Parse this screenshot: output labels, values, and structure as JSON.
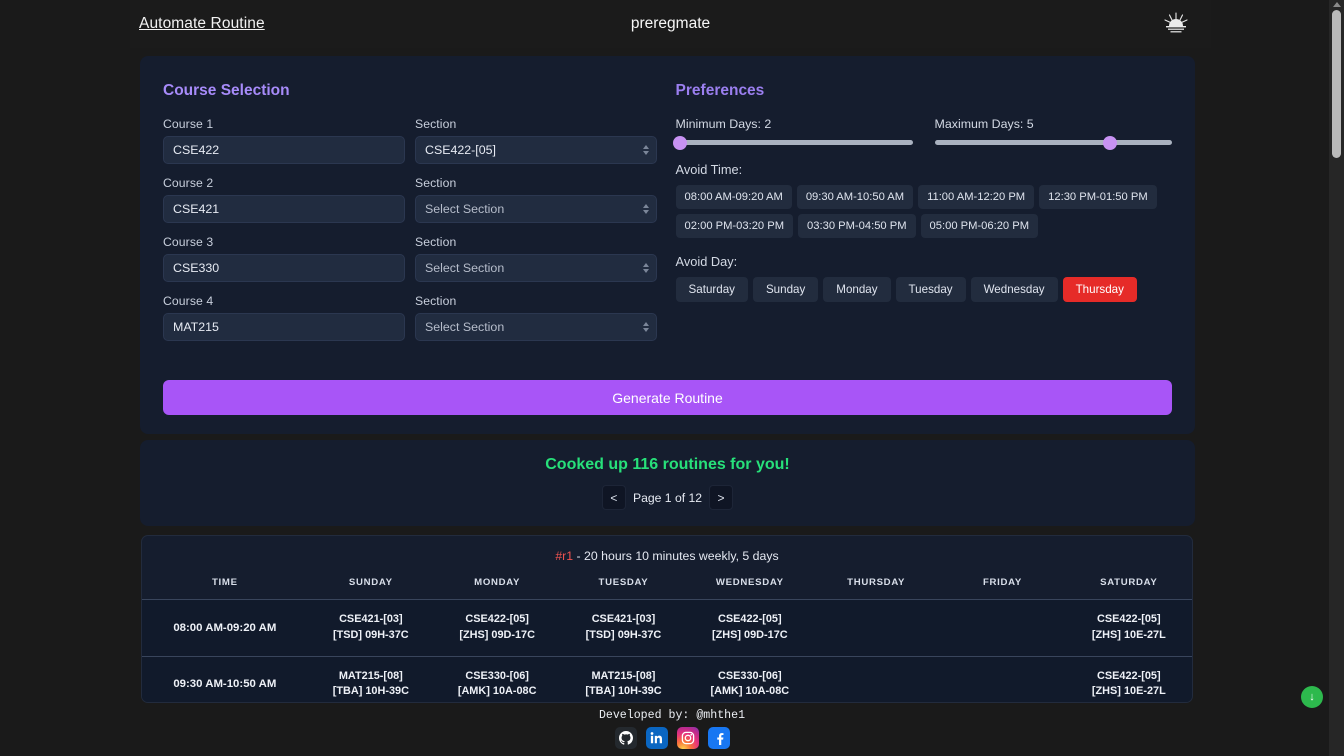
{
  "header": {
    "left_link": "Automate Routine",
    "title": "preregmate",
    "theme_toggle_icon": "sunrise-icon"
  },
  "course_selection": {
    "title": "Course Selection",
    "section_label": "Section",
    "section_placeholder": "Select Section",
    "rows": [
      {
        "course_label": "Course 1",
        "course_value": "CSE422",
        "section_label": "Section",
        "section_value": "CSE422-[05]",
        "section_is_placeholder": false
      },
      {
        "course_label": "Course 2",
        "course_value": "CSE421",
        "section_label": "Section",
        "section_value": "Select Section",
        "section_is_placeholder": true
      },
      {
        "course_label": "Course 3",
        "course_value": "CSE330",
        "section_label": "Section",
        "section_value": "Select Section",
        "section_is_placeholder": true
      },
      {
        "course_label": "Course 4",
        "course_value": "MAT215",
        "section_label": "Section",
        "section_value": "Select Section",
        "section_is_placeholder": true
      }
    ]
  },
  "preferences": {
    "title": "Preferences",
    "min_days_label": "Minimum Days: 2",
    "min_days_value": 2,
    "min_days_percent": 2,
    "max_days_label": "Maximum Days: 5",
    "max_days_value": 5,
    "max_days_percent": 74,
    "avoid_time_label": "Avoid Time:",
    "avoid_time_slots": [
      "08:00 AM-09:20 AM",
      "09:30 AM-10:50 AM",
      "11:00 AM-12:20 PM",
      "12:30 PM-01:50 PM",
      "02:00 PM-03:20 PM",
      "03:30 PM-04:50 PM",
      "05:00 PM-06:20 PM"
    ],
    "avoid_day_label": "Avoid Day:",
    "avoid_days": [
      {
        "label": "Saturday",
        "selected": false
      },
      {
        "label": "Sunday",
        "selected": false
      },
      {
        "label": "Monday",
        "selected": false
      },
      {
        "label": "Tuesday",
        "selected": false
      },
      {
        "label": "Wednesday",
        "selected": false
      },
      {
        "label": "Thursday",
        "selected": true
      }
    ]
  },
  "generate_button": "Generate Routine",
  "result": {
    "message": "Cooked up 116 routines for you!",
    "routine_count": 116,
    "prev_label": "<",
    "next_label": ">",
    "page_label": "Page 1 of 12",
    "current_page": 1,
    "total_pages": 12
  },
  "routine": {
    "id": "#r1",
    "summary": " - 20 hours 10 minutes weekly, 5 days",
    "columns": [
      "TIME",
      "SUNDAY",
      "MONDAY",
      "TUESDAY",
      "WEDNESDAY",
      "THURSDAY",
      "FRIDAY",
      "SATURDAY"
    ],
    "rows": [
      {
        "time": "08:00 AM-09:20 AM",
        "cells": [
          {
            "course": "CSE421-[03]",
            "room": "[TSD] 09H-37C"
          },
          {
            "course": "CSE422-[05]",
            "room": "[ZHS] 09D-17C"
          },
          {
            "course": "CSE421-[03]",
            "room": "[TSD] 09H-37C"
          },
          {
            "course": "CSE422-[05]",
            "room": "[ZHS] 09D-17C"
          },
          {
            "course": "",
            "room": ""
          },
          {
            "course": "",
            "room": ""
          },
          {
            "course": "CSE422-[05]",
            "room": "[ZHS] 10E-27L"
          }
        ]
      },
      {
        "time": "09:30 AM-10:50 AM",
        "cells": [
          {
            "course": "MAT215-[08]",
            "room": "[TBA] 10H-39C"
          },
          {
            "course": "CSE330-[06]",
            "room": "[AMK] 10A-08C"
          },
          {
            "course": "MAT215-[08]",
            "room": "[TBA] 10H-39C"
          },
          {
            "course": "CSE330-[06]",
            "room": "[AMK] 10A-08C"
          },
          {
            "course": "",
            "room": ""
          },
          {
            "course": "",
            "room": ""
          },
          {
            "course": "CSE422-[05]",
            "room": "[ZHS] 10E-27L"
          }
        ]
      }
    ]
  },
  "footer": {
    "developed_by": "Developed by: @mhthe1",
    "socials": [
      {
        "name": "github-icon",
        "label": "GitHub"
      },
      {
        "name": "linkedin-icon",
        "label": "LinkedIn"
      },
      {
        "name": "instagram-icon",
        "label": "Instagram"
      },
      {
        "name": "facebook-icon",
        "label": "Facebook"
      }
    ]
  },
  "scroll_to_bottom_button": "↓",
  "colors": {
    "page_bg": "#1a1a1a",
    "panel_bg": "#151d2e",
    "accent_purple": "#a855f7",
    "heading_purple": "#a78bfa",
    "success_green": "#27e07a",
    "danger_red": "#e62b28",
    "routine_id_red": "#ef5350"
  }
}
